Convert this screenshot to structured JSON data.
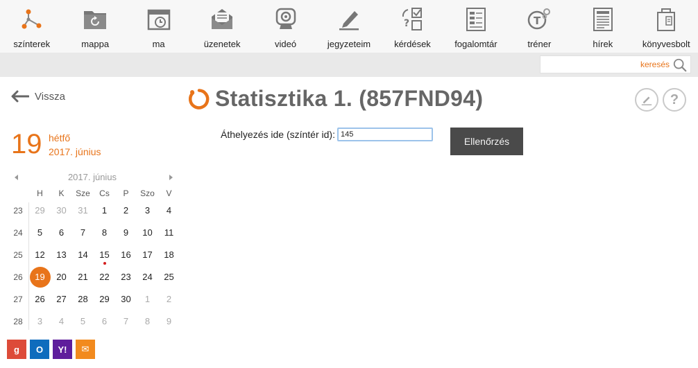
{
  "nav": [
    {
      "id": "szinterek",
      "label": "színterek",
      "icon": "network-icon"
    },
    {
      "id": "mappa",
      "label": "mappa",
      "icon": "folder-refresh-icon"
    },
    {
      "id": "ma",
      "label": "ma",
      "icon": "calendar-clock-icon"
    },
    {
      "id": "uzenetek",
      "label": "üzenetek",
      "icon": "envelope-icon"
    },
    {
      "id": "video",
      "label": "videó",
      "icon": "webcam-icon"
    },
    {
      "id": "jegyzeteim",
      "label": "jegyzeteim",
      "icon": "pencil-icon"
    },
    {
      "id": "kerdesek",
      "label": "kérdések",
      "icon": "quiz-icon"
    },
    {
      "id": "fogalomtar",
      "label": "fogalomtár",
      "icon": "glossary-icon"
    },
    {
      "id": "trener",
      "label": "tréner",
      "icon": "trainer-icon"
    },
    {
      "id": "hirek",
      "label": "hírek",
      "icon": "newspaper-icon"
    },
    {
      "id": "konyvesbolt",
      "label": "könyvesbolt",
      "icon": "bookstore-icon"
    }
  ],
  "search": {
    "placeholder": "keresés"
  },
  "back": {
    "label": "Vissza"
  },
  "title": "Statisztika 1. (857FND94)",
  "form": {
    "label": "Áthelyezés ide (színtér id):",
    "value": "145",
    "button": "Ellenőrzés"
  },
  "today": {
    "day": "19",
    "weekday": "hétfő",
    "year_month": "2017. június"
  },
  "calendar": {
    "title": "2017. június",
    "weekdays": [
      "H",
      "K",
      "Sze",
      "Cs",
      "P",
      "Szo",
      "V"
    ],
    "weeks": [
      {
        "num": "23",
        "days": [
          {
            "d": "29",
            "o": true
          },
          {
            "d": "30",
            "o": true
          },
          {
            "d": "31",
            "o": true
          },
          {
            "d": "1"
          },
          {
            "d": "2"
          },
          {
            "d": "3"
          },
          {
            "d": "4"
          }
        ]
      },
      {
        "num": "24",
        "days": [
          {
            "d": "5"
          },
          {
            "d": "6"
          },
          {
            "d": "7"
          },
          {
            "d": "8"
          },
          {
            "d": "9"
          },
          {
            "d": "10"
          },
          {
            "d": "11"
          }
        ]
      },
      {
        "num": "25",
        "days": [
          {
            "d": "12"
          },
          {
            "d": "13"
          },
          {
            "d": "14"
          },
          {
            "d": "15",
            "event": true
          },
          {
            "d": "16"
          },
          {
            "d": "17"
          },
          {
            "d": "18"
          }
        ]
      },
      {
        "num": "26",
        "days": [
          {
            "d": "19",
            "selected": true
          },
          {
            "d": "20"
          },
          {
            "d": "21"
          },
          {
            "d": "22"
          },
          {
            "d": "23"
          },
          {
            "d": "24"
          },
          {
            "d": "25"
          }
        ]
      },
      {
        "num": "27",
        "days": [
          {
            "d": "26"
          },
          {
            "d": "27"
          },
          {
            "d": "28"
          },
          {
            "d": "29"
          },
          {
            "d": "30"
          },
          {
            "d": "1",
            "o": true
          },
          {
            "d": "2",
            "o": true
          }
        ]
      },
      {
        "num": "28",
        "days": [
          {
            "d": "3",
            "o": true
          },
          {
            "d": "4",
            "o": true
          },
          {
            "d": "5",
            "o": true
          },
          {
            "d": "6",
            "o": true
          },
          {
            "d": "7",
            "o": true
          },
          {
            "d": "8",
            "o": true
          },
          {
            "d": "9",
            "o": true
          }
        ]
      }
    ]
  },
  "share": [
    {
      "id": "google",
      "glyph": "g",
      "color": "#dd4b39",
      "icon": "google-icon"
    },
    {
      "id": "outlook",
      "glyph": "O",
      "color": "#0f6cbd",
      "icon": "outlook-icon"
    },
    {
      "id": "yahoo",
      "glyph": "Y!",
      "color": "#5f1e9c",
      "icon": "yahoo-icon"
    },
    {
      "id": "mail",
      "glyph": "✉",
      "color": "#f28a1e",
      "icon": "mail-icon"
    }
  ],
  "colors": {
    "accent": "#e8741a",
    "dark_button": "#4a4a4a",
    "nav_icon": "#777777"
  }
}
